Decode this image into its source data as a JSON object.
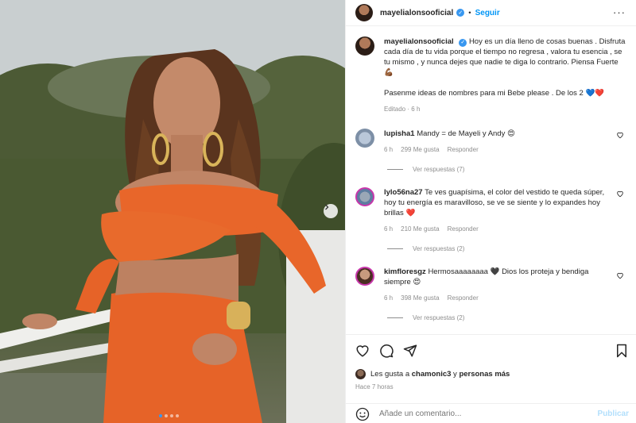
{
  "post": {
    "username": "mayelialonsooficial",
    "follow_label": "Seguir",
    "separator": "•",
    "more_label": "···"
  },
  "caption": {
    "username": "mayelialonsooficial",
    "text1": "Hoy es un día lleno de cosas buenas . Disfruta cada día de tu vida porque el tiempo no regresa , valora tu esencia , se tu mismo , y nunca dejes que nadie te diga lo contrario. Piensa Fuerte 💪🏾",
    "text2": "Pasenme ideas de nombres para mi Bebe please . De los 2 💙❤️",
    "edited": "Editado",
    "time": "6 h"
  },
  "comments": [
    {
      "username": "lupisha1",
      "text": "Mandy = de Mayeli y Andy 😍",
      "time": "6 h",
      "likes": "299 Me gusta",
      "reply": "Responder",
      "view_replies": "Ver respuestas (7)"
    },
    {
      "username": "lylo56na27",
      "text": "Te ves guapísima, el color del vestido te queda súper, hoy tu energía es maravilloso, se ve se siente y lo expandes hoy brillas ❤️",
      "time": "6 h",
      "likes": "210 Me gusta",
      "reply": "Responder",
      "view_replies": "Ver respuestas (2)"
    },
    {
      "username": "kimfloresgz",
      "text": "Hermosaaaaaaaa 🖤 Dios los proteja y bendiga siempre 😍",
      "time": "6 h",
      "likes": "398 Me gusta",
      "reply": "Responder",
      "view_replies": "Ver respuestas (2)"
    }
  ],
  "likes_line": {
    "prefix": "Les gusta a",
    "user": "chamonic3",
    "conj": "y",
    "others": "personas más"
  },
  "time_ago": "Hace 7 horas",
  "add_comment": {
    "placeholder": "Añade un comentario...",
    "publish_label": "Publicar"
  },
  "colors": {
    "accent": "#0095f6",
    "dress": "#e8662a",
    "publish_disabled": "#b2dffc"
  },
  "carousel": {
    "active_index": 1,
    "count": 4
  }
}
